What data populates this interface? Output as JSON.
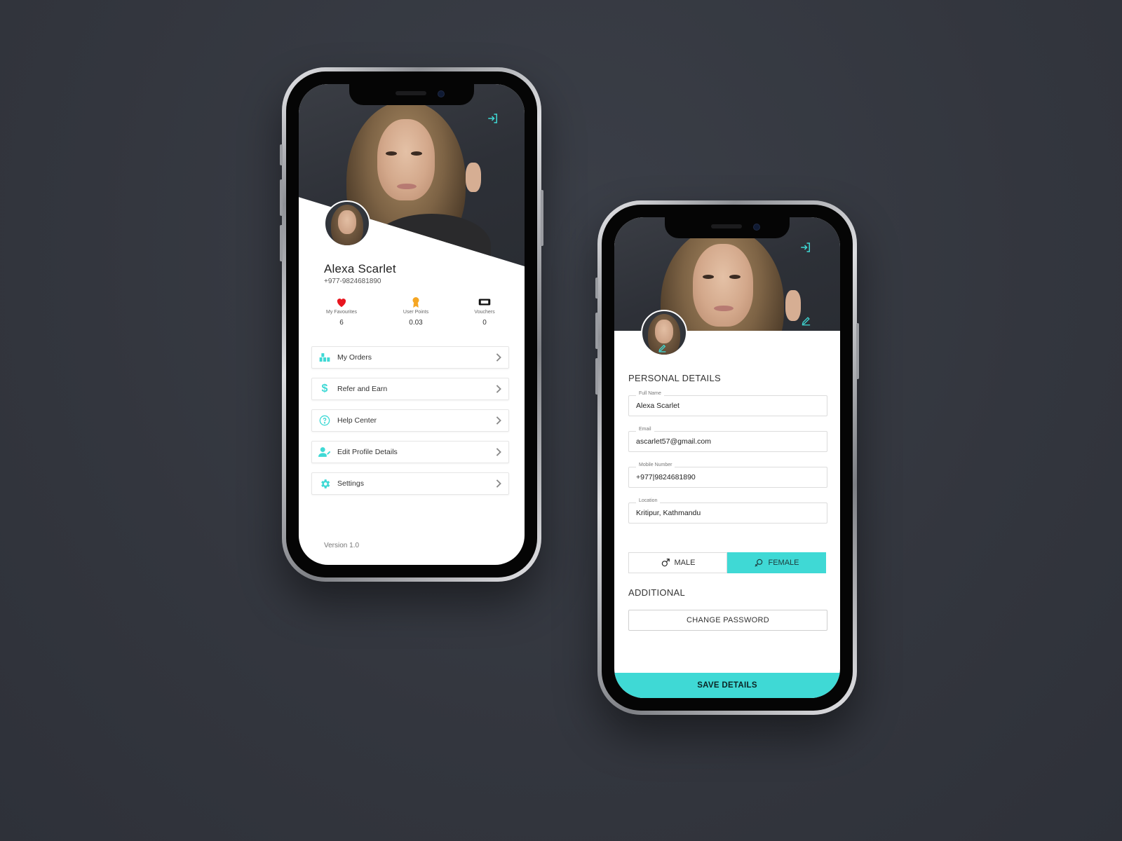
{
  "colors": {
    "accent": "#3fd9d5",
    "background": "#33363e",
    "heart": "#e8161f",
    "points": "#f5a623"
  },
  "profile_screen": {
    "logout_icon": "logout-icon",
    "user": {
      "name": "Alexa Scarlet",
      "phone": "+977-9824681890"
    },
    "stats": [
      {
        "label": "My Favourites",
        "value": "6",
        "icon": "heart-icon"
      },
      {
        "label": "User Points",
        "value": "0.03",
        "icon": "medal-icon"
      },
      {
        "label": "Vouchers",
        "value": "0",
        "icon": "ticket-icon"
      }
    ],
    "menu": [
      {
        "label": "My Orders",
        "icon": "boxes-icon"
      },
      {
        "label": "Refer and Earn",
        "icon": "dollar-icon"
      },
      {
        "label": "Help Center",
        "icon": "help-icon"
      },
      {
        "label": "Edit Profile Details",
        "icon": "edit-user-icon"
      },
      {
        "label": "Settings",
        "icon": "gear-icon"
      }
    ],
    "version": "Version 1.0"
  },
  "edit_screen": {
    "personal_title": "PERSONAL DETAILS",
    "fields": {
      "full_name": {
        "label": "Full Name",
        "value": "Alexa Scarlet"
      },
      "email": {
        "label": "Email",
        "value": "ascarlet57@gmail.com"
      },
      "mobile": {
        "label": "Mobile Number",
        "value": "+977|9824681890"
      },
      "location": {
        "label": "Location",
        "value": "Kritipur, Kathmandu"
      }
    },
    "gender": {
      "male": "MALE",
      "female": "FEMALE",
      "selected": "FEMALE"
    },
    "additional_title": "ADDITIONAL",
    "change_password": "CHANGE PASSWORD",
    "save": "SAVE DETAILS"
  }
}
